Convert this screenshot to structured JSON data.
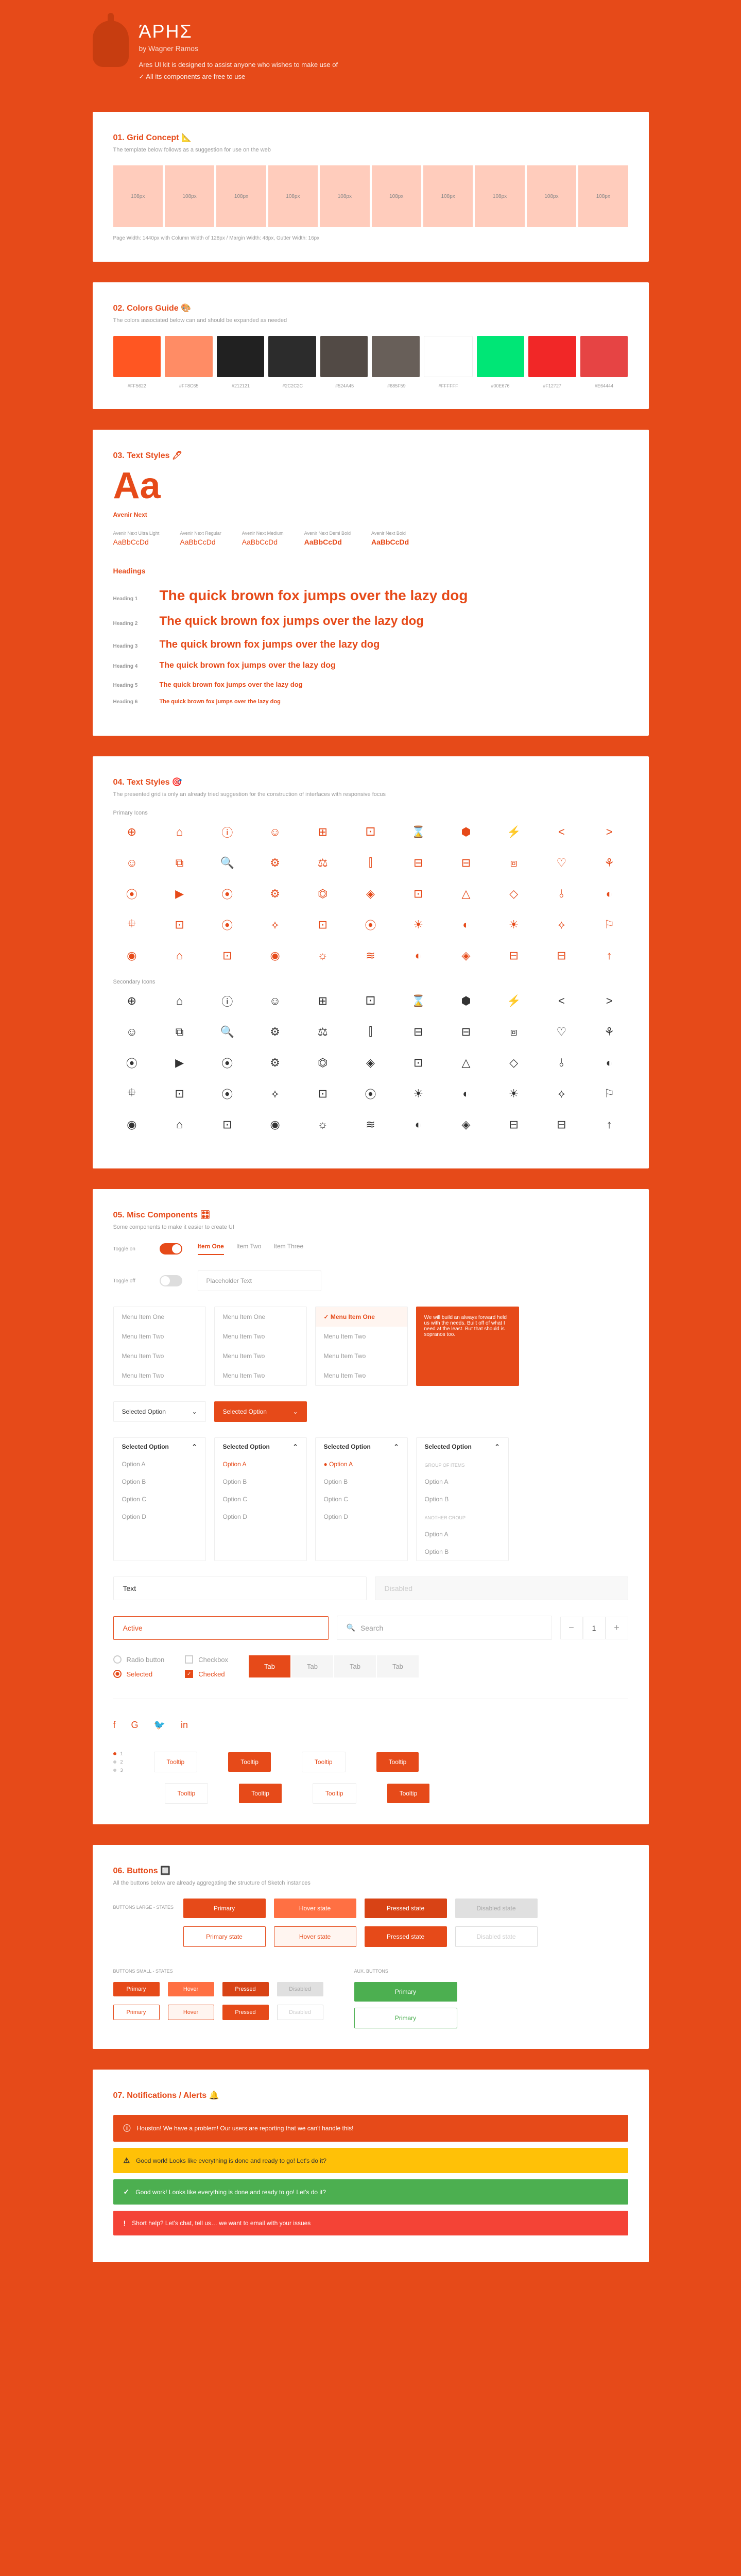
{
  "header": {
    "title": "ΆΡΗΣ",
    "by": "by Wagner Ramos",
    "desc": "Ares UI kit is designed to assist anyone who wishes to make use of",
    "check": "✓ All its components are free to use"
  },
  "s1": {
    "title": "01. Grid Concept 📐",
    "sub": "The template below follows as a suggestion for use on the web",
    "col": "108px",
    "note": "Page Width: 1440px with Column Width of 128px / Margin Width: 48px, Gutter Width: 16px"
  },
  "s2": {
    "title": "02. Colors Guide 🎨",
    "sub": "The colors associated below can and should be expanded as needed",
    "colors": [
      "#FF5622",
      "#FF8C65",
      "#212121",
      "#2C2C2C",
      "#524A45",
      "#685F59",
      "#FFFFFF",
      "#00E676",
      "#F12727",
      "#E64444"
    ],
    "labels": [
      "#FF5622",
      "#FF8C65",
      "#212121",
      "#2C2C2C",
      "#524A45",
      "#685F59",
      "#FFFFFF",
      "#00E676",
      "#F12727",
      "#E64444"
    ]
  },
  "s3": {
    "title": "03. Text Styles 🖊",
    "aa": "Aa",
    "font": "Avenir Next",
    "weights": [
      {
        "label": "Avenir Next Ultra Light",
        "sample": "AaBbCcDd",
        "w": "200"
      },
      {
        "label": "Avenir Next Regular",
        "sample": "AaBbCcDd",
        "w": "400"
      },
      {
        "label": "Avenir Next Medium",
        "sample": "AaBbCcDd",
        "w": "500"
      },
      {
        "label": "Avenir Next Demi Bold",
        "sample": "AaBbCcDd",
        "w": "600"
      },
      {
        "label": "Avenir Next Bold",
        "sample": "AaBbCcDd",
        "w": "700"
      }
    ],
    "headings": "Headings",
    "sample": "The quick brown fox jumps over the lazy dog",
    "h": [
      "Heading 1",
      "Heading 2",
      "Heading 3",
      "Heading 4",
      "Heading 5",
      "Heading 6"
    ]
  },
  "s4": {
    "title": "04. Text Styles 🎯",
    "sub": "The presented grid is only an already tried suggestion for the construction of interfaces with responsive focus",
    "primary": "Primary Icons",
    "secondary": "Secondary Icons"
  },
  "icons": [
    "⊕",
    "⌂",
    "ⓘ",
    "☺",
    "⊞",
    "⚀",
    "⌛",
    "⬢",
    "⚡",
    "<",
    ">",
    "☺",
    "⧉",
    "🔍",
    "⚙",
    "⚖",
    "⫿",
    "⊟",
    "⊟",
    "⧈",
    "♡",
    "⚘",
    "⦿",
    "▶",
    "⦿",
    "⚙",
    "⏣",
    "◈",
    "⊡",
    "△",
    "◇",
    "⫰",
    "◐",
    "⯐",
    "⊡",
    "⦿",
    "⟡",
    "⊡",
    "⦿",
    "☀",
    "◐",
    "☀",
    "⟡",
    "⚐",
    "◉",
    "⌂",
    "⊡",
    "◉",
    "☼",
    "≋",
    "◐",
    "◈",
    "⊟",
    "⊟",
    "↑"
  ],
  "s5": {
    "title": "05. Misc Components 🎛",
    "sub": "Some components to make it easier to create UI",
    "toggle_label": "Toggle on",
    "toggle_off": "Toggle off",
    "tabs": [
      "Item One",
      "Item Two",
      "Item Three"
    ],
    "field_ph": "Placeholder Text",
    "menu": [
      "Menu Item One",
      "Menu Item Two",
      "Menu Item Two",
      "Menu Item Two"
    ],
    "menu_active": "Menu Item One",
    "tooltip": "We will build an always forward held us with the needs. Built off of what I need at the least. But that should is sopranos too.",
    "select": "Selected Option",
    "opts": [
      "Option A",
      "Option B",
      "Option C",
      "Option D"
    ],
    "group1": "GROUP OF ITEMS",
    "group2": "ANOTHER GROUP",
    "inp_text": "Text",
    "inp_active": "Active",
    "inp_disabled": "Disabled",
    "inp_search": "Search",
    "step_val": "1",
    "radio": "Radio button",
    "radio_sel": "Selected",
    "cb": "Checkbox",
    "cb_sel": "Checked",
    "tab_btn": "Tab",
    "tt": "Tooltip"
  },
  "s6": {
    "title": "06. Buttons 🔲",
    "sub": "All the buttons below are already aggregating the structure of Sketch instances",
    "large": "BUTTONS LARGE - STATES",
    "small": "BUTTONS SMALL - STATES",
    "aux": "AUX. BUTTONS",
    "primary": "Primary",
    "hover": "Hover state",
    "pressed": "Pressed state",
    "disabled": "Disabled state",
    "primary_state": "Primary state",
    "hover_state": "Hover state",
    "pressed_state": "Pressed state",
    "disabled_state": "Disabled state"
  },
  "s7": {
    "title": "07. Notifications / Alerts 🔔",
    "info": "Houston! We have a problem! Our users are reporting that we can't handle this!",
    "warn": "Good work! Looks like everything is done and ready to go! Let's do it?",
    "success": "Good work! Looks like everything is done and ready to go! Let's do it?",
    "danger": "Short help? Let's chat, tell us… we want to email with your issues"
  }
}
